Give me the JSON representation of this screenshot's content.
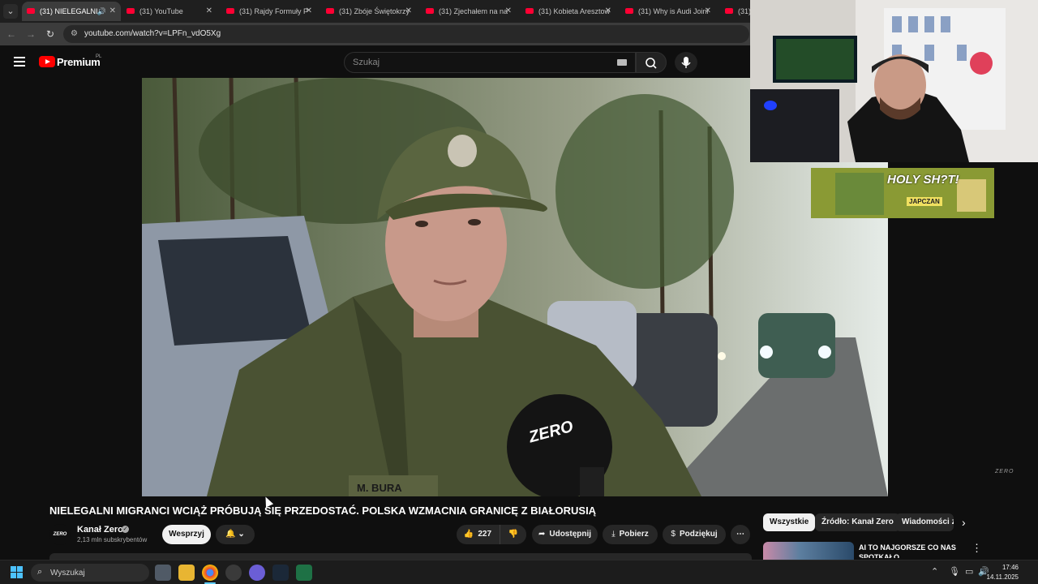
{
  "browser": {
    "tabs": [
      {
        "label": "(31) NIELEGALNI",
        "active": true
      },
      {
        "label": "(31) YouTube"
      },
      {
        "label": "(31) Rajdy Formuły P"
      },
      {
        "label": "(31) Zbóje Świętokrzy"
      },
      {
        "label": "(31) Zjechałem na na"
      },
      {
        "label": "(31) Kobieta Aresztow"
      },
      {
        "label": "(31) Why is Audi Joini"
      },
      {
        "label": "(31)"
      }
    ],
    "url": "youtube.com/watch?v=LPFn_vdO5Xg"
  },
  "youtube": {
    "logo_text": "Premium",
    "region": "PL",
    "search_placeholder": "Szukaj"
  },
  "video": {
    "title": "NIELEGALNI MIGRANCI WCIĄŻ PRÓBUJĄ SIĘ PRZEDOSTAĆ. POLSKA WZMACNIA GRANICĘ Z BIAŁORUSIĄ",
    "watermark": "ZERO",
    "mic_brand": "ZERO",
    "name_tag": "M. BURA"
  },
  "channel": {
    "name": "Kanał Zero",
    "subscribers": "2,13 mln subskrybentów",
    "avatar_text": "ZERO"
  },
  "actions": {
    "join": "Wesprzyj",
    "likes": "227",
    "share": "Udostępnij",
    "download": "Pobierz",
    "thanks": "Podziękuj"
  },
  "chips": [
    "Wszystkie",
    "Źródło: Kanał Zero",
    "Wiadomości z"
  ],
  "recommendation": {
    "title": "AI TO NAJGORSZE CO NAS SPOTKAŁO"
  },
  "overlay": {
    "promo_title": "HOLY SH?T!",
    "promo_brand": "JAPCZAN"
  },
  "taskbar": {
    "search": "Wyszukaj",
    "time": "17:46",
    "date": "14.11.2025"
  },
  "colors": {
    "yt_red": "#ff0000",
    "bg": "#0f0f0f",
    "accent_blue": "#4cc2ff"
  }
}
